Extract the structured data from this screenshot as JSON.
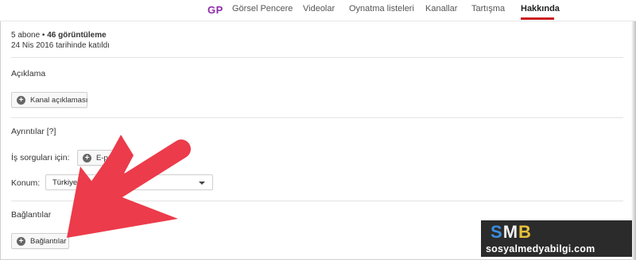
{
  "nav": {
    "logo": "GP",
    "tabs": [
      "Görsel Pencere",
      "Videolar",
      "Oynatma listeleri",
      "Kanallar",
      "Tartışma",
      "Hakkında"
    ],
    "active_tab": "Hakkında"
  },
  "stats": {
    "subscribers": "5 abone",
    "separator": " • ",
    "views": "46 görüntüleme",
    "joined": "24 Nis 2016 tarihinde katıldı"
  },
  "description": {
    "title": "Açıklama",
    "button": "Kanal açıklaması"
  },
  "details": {
    "title": "Ayrıntılar [?]",
    "business_label": "İş sorguları için:",
    "business_button": "E-po",
    "location_label": "Konum:",
    "location_value": "Türkiye"
  },
  "links": {
    "title": "Bağlantılar",
    "button": "Bağlantılar"
  },
  "badge": {
    "logo_s": "S",
    "logo_m": "M",
    "logo_b": "B",
    "site": "sosyalmedyabilgi.com"
  },
  "colors": {
    "accent": "#cc181e",
    "arrow": "#ec3b4b",
    "logo_purple": "#8e2aa8"
  }
}
